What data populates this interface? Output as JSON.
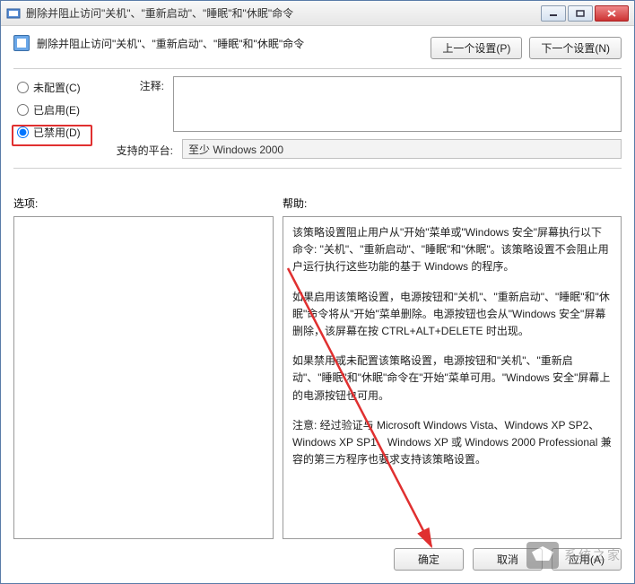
{
  "window": {
    "title": "删除并阻止访问\"关机\"、\"重新启动\"、\"睡眠\"和\"休眠\"命令"
  },
  "header": {
    "title": "删除并阻止访问\"关机\"、\"重新启动\"、\"睡眠\"和\"休眠\"命令",
    "prev_btn": "上一个设置(P)",
    "next_btn": "下一个设置(N)"
  },
  "radios": {
    "not_configured": "未配置(C)",
    "enabled": "已启用(E)",
    "disabled": "已禁用(D)"
  },
  "labels": {
    "comment": "注释:",
    "platform": "支持的平台:",
    "options": "选项:",
    "help": "帮助:"
  },
  "fields": {
    "comment_value": "",
    "platform_value": "至少 Windows 2000"
  },
  "help": {
    "p1": "该策略设置阻止用户从\"开始\"菜单或\"Windows 安全\"屏幕执行以下命令: \"关机\"、\"重新启动\"、\"睡眠\"和\"休眠\"。该策略设置不会阻止用户运行执行这些功能的基于 Windows 的程序。",
    "p2": "如果启用该策略设置，电源按钮和\"关机\"、\"重新启动\"、\"睡眠\"和\"休眠\"命令将从\"开始\"菜单删除。电源按钮也会从\"Windows 安全\"屏幕删除，该屏幕在按 CTRL+ALT+DELETE 时出现。",
    "p3": "如果禁用或未配置该策略设置，电源按钮和\"关机\"、\"重新启动\"、\"睡眠\"和\"休眠\"命令在\"开始\"菜单可用。\"Windows 安全\"屏幕上的电源按钮也可用。",
    "p4": "注意: 经过验证与 Microsoft Windows Vista、Windows XP SP2、Windows XP SP1、Windows XP 或 Windows 2000 Professional 兼容的第三方程序也要求支持该策略设置。"
  },
  "buttons": {
    "ok": "确定",
    "cancel": "取消",
    "apply": "应用(A)"
  },
  "watermark": {
    "text": "系统之家"
  }
}
